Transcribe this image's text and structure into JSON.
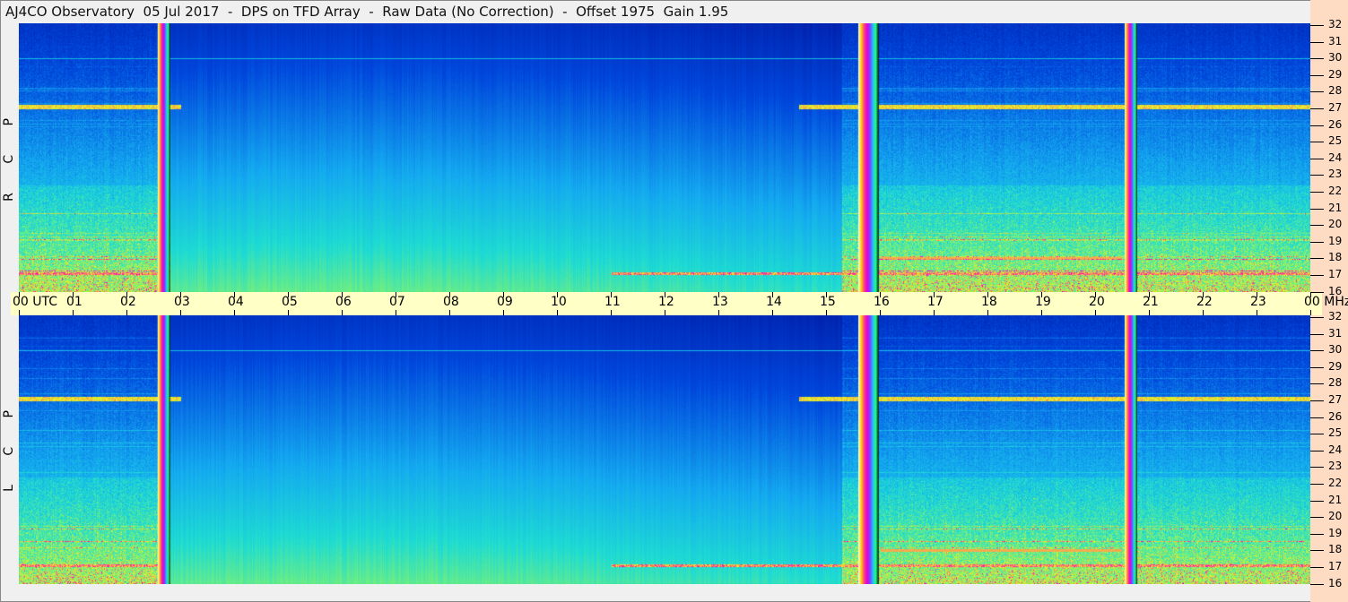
{
  "header": {
    "title": "AJ4CO Observatory  05 Jul 2017  -  DPS on TFD Array  -  Raw Data (No Correction)  -  Offset 1975  Gain 1.95"
  },
  "chart_data": {
    "type": "heatmap",
    "title": "AJ4CO Observatory  05 Jul 2017  -  DPS on TFD Array  -  Raw Data (No Correction)  -  Offset 1975  Gain 1.95",
    "x_unit": "UTC",
    "y_unit": "MHz",
    "x_range": [
      0,
      24
    ],
    "y_range": [
      16,
      32
    ],
    "x_tick_labels": [
      "00 UTC",
      "01",
      "02",
      "03",
      "04",
      "05",
      "06",
      "07",
      "08",
      "09",
      "10",
      "11",
      "12",
      "13",
      "14",
      "15",
      "16",
      "17",
      "18",
      "19",
      "20",
      "21",
      "22",
      "23",
      "00 MHz"
    ],
    "y_tick_labels": [
      "32",
      "31",
      "30",
      "29",
      "28",
      "27",
      "26",
      "25",
      "24",
      "23",
      "22",
      "21",
      "20",
      "19",
      "18",
      "17",
      "16"
    ],
    "panels": [
      {
        "label": "R C P"
      },
      {
        "label": "L C P"
      }
    ],
    "calibration_bars_utc": [
      [
        2.58,
        2.81
      ],
      [
        15.6,
        15.98
      ],
      [
        20.55,
        20.78
      ]
    ],
    "interference_lines_mhz": [
      27.1,
      30.0,
      17.1,
      18.0
    ],
    "colors": {
      "low": "#0010a0",
      "mid": "#20d8d8",
      "high": "#f0f020",
      "peak": "#ff00c0",
      "axis_band": "#ffffc6",
      "right_margin": "#fddcc3"
    }
  }
}
